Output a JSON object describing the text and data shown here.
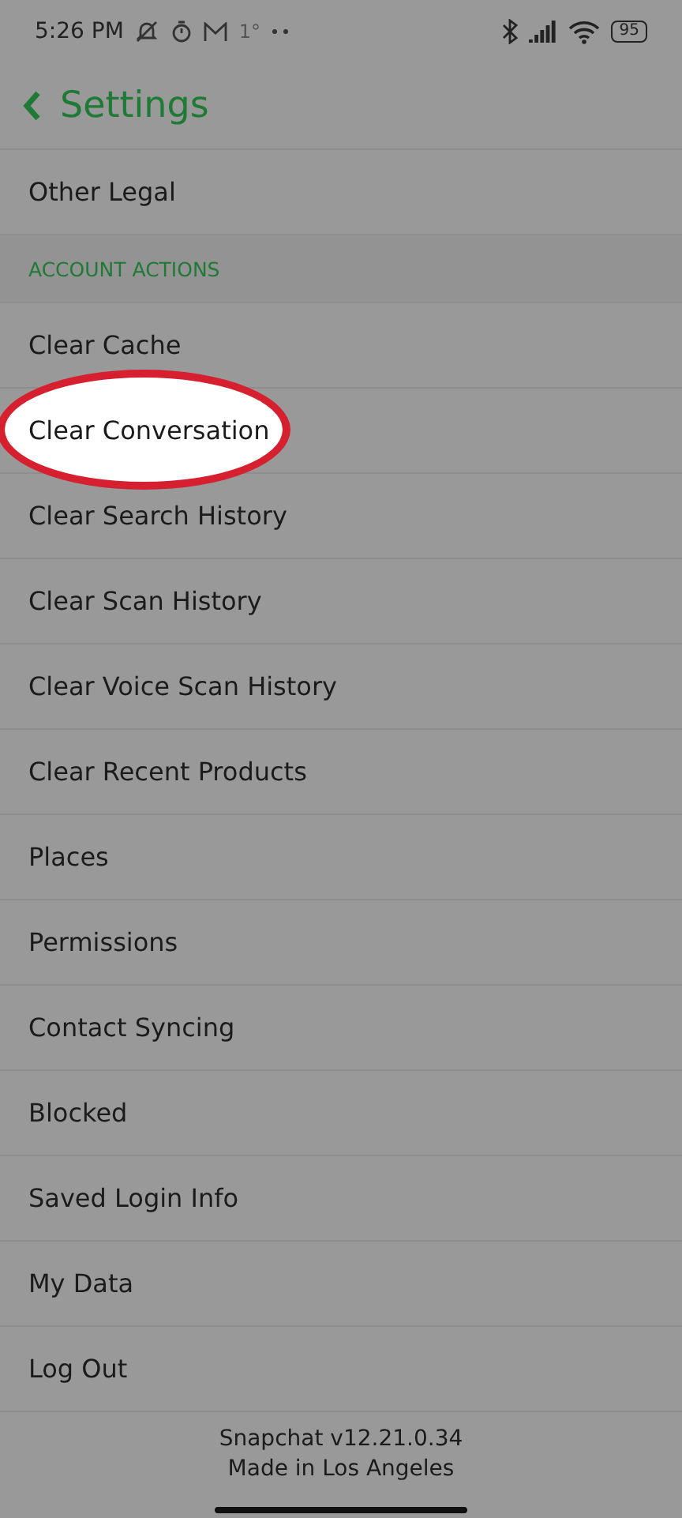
{
  "status_bar": {
    "time": "5:26 PM",
    "temperature": "1°",
    "battery": "95"
  },
  "header": {
    "title": "Settings"
  },
  "items": [
    {
      "label": "Other Legal",
      "highlighted": false
    }
  ],
  "section": {
    "title": "ACCOUNT ACTIONS",
    "items": [
      {
        "label": "Clear Cache",
        "highlighted": false
      },
      {
        "label": "Clear Conversation",
        "highlighted": true
      },
      {
        "label": "Clear Search History",
        "highlighted": false
      },
      {
        "label": "Clear Scan History",
        "highlighted": false
      },
      {
        "label": "Clear Voice Scan History",
        "highlighted": false
      },
      {
        "label": "Clear Recent Products",
        "highlighted": false
      },
      {
        "label": "Places",
        "highlighted": false
      },
      {
        "label": "Permissions",
        "highlighted": false
      },
      {
        "label": "Contact Syncing",
        "highlighted": false
      },
      {
        "label": "Blocked",
        "highlighted": false
      },
      {
        "label": "Saved Login Info",
        "highlighted": false
      },
      {
        "label": "My Data",
        "highlighted": false
      },
      {
        "label": "Log Out",
        "highlighted": false
      }
    ]
  },
  "footer": {
    "lines": [
      "Snapchat v12.21.0.34",
      "Made in Los Angeles"
    ]
  }
}
